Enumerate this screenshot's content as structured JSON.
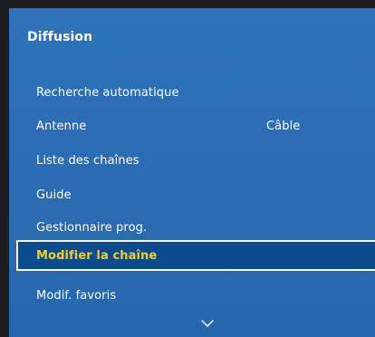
{
  "menu": {
    "title": "Diffusion",
    "items": [
      {
        "label": "Recherche automatique"
      },
      {
        "label": "Antenne",
        "value": "Câble"
      },
      {
        "label": "Liste des chaînes"
      },
      {
        "label": "Guide"
      },
      {
        "label": "Gestionnaire prog."
      },
      {
        "label": "Modifier la chaîne",
        "selected": true
      },
      {
        "label": "Modif. favoris"
      }
    ]
  },
  "colors": {
    "panel_background": "#2a6cb3",
    "selected_background": "#0d4b8f",
    "selected_text": "#f4cf20",
    "selected_border": "#ffffff",
    "text": "#ffffff",
    "screen_background": "#1b1d21"
  },
  "icons": {
    "scroll": "chevron-down-icon"
  }
}
